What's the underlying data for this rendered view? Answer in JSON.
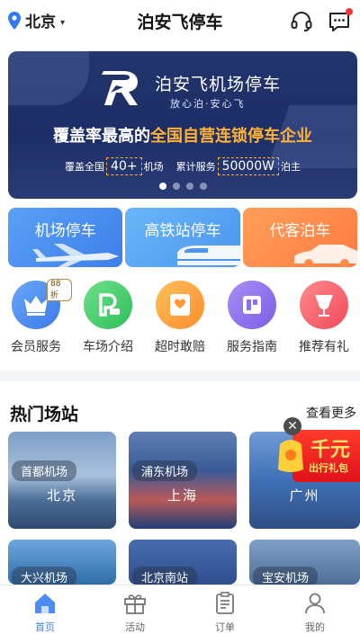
{
  "header": {
    "city": "北京",
    "title": "泊安飞停车",
    "icons": [
      "location-pin-icon",
      "headset-icon",
      "message-icon"
    ]
  },
  "banner": {
    "brand": "泊安飞机场停车",
    "slogan": "放心泊·安心飞",
    "headline_prefix": "覆盖率最高的",
    "headline_highlight": "全国自营连锁停车企业",
    "stat1_prefix": "覆盖全国",
    "stat1_value": "40+",
    "stat1_suffix": "机场",
    "stat2_prefix": "累计服务",
    "stat2_value": "50000W",
    "stat2_suffix": "泊主",
    "slide_count": 4,
    "active_slide": 1
  },
  "services": [
    {
      "label": "机场停车",
      "icon": "airplane-icon"
    },
    {
      "label": "高铁站停车",
      "icon": "high-speed-train-icon"
    },
    {
      "label": "代客泊车",
      "icon": "car-icon"
    }
  ],
  "functions": [
    {
      "label": "会员服务",
      "icon": "crown-icon",
      "badge": "88折"
    },
    {
      "label": "车场介绍",
      "icon": "parking-icon",
      "badge": ""
    },
    {
      "label": "超时敢赔",
      "icon": "compensation-icon",
      "badge": ""
    },
    {
      "label": "服务指南",
      "icon": "guide-icon",
      "badge": ""
    },
    {
      "label": "推荐有礼",
      "icon": "gift-wine-icon",
      "badge": ""
    }
  ],
  "hot": {
    "title": "热门场站",
    "more": "查看更多",
    "stations": [
      {
        "name": "首都机场",
        "city": "北京"
      },
      {
        "name": "浦东机场",
        "city": "上海"
      },
      {
        "name": "",
        "city": "广州"
      },
      {
        "name": "大兴机场",
        "city": ""
      },
      {
        "name": "北京南站",
        "city": ""
      },
      {
        "name": "宝安机场",
        "city": ""
      }
    ]
  },
  "promo": {
    "big": "千元",
    "small": "出行礼包",
    "close": "✕"
  },
  "tabs": [
    {
      "label": "首页",
      "icon": "home-icon",
      "active": true
    },
    {
      "label": "活动",
      "icon": "gift-icon",
      "active": false
    },
    {
      "label": "订单",
      "icon": "order-icon",
      "active": false
    },
    {
      "label": "我的",
      "icon": "user-icon",
      "active": false
    }
  ],
  "colors": {
    "accent": "#3b82f6",
    "banner_bg": "#23356e",
    "highlight": "#ffb238",
    "promo_red": "#e0101a"
  }
}
